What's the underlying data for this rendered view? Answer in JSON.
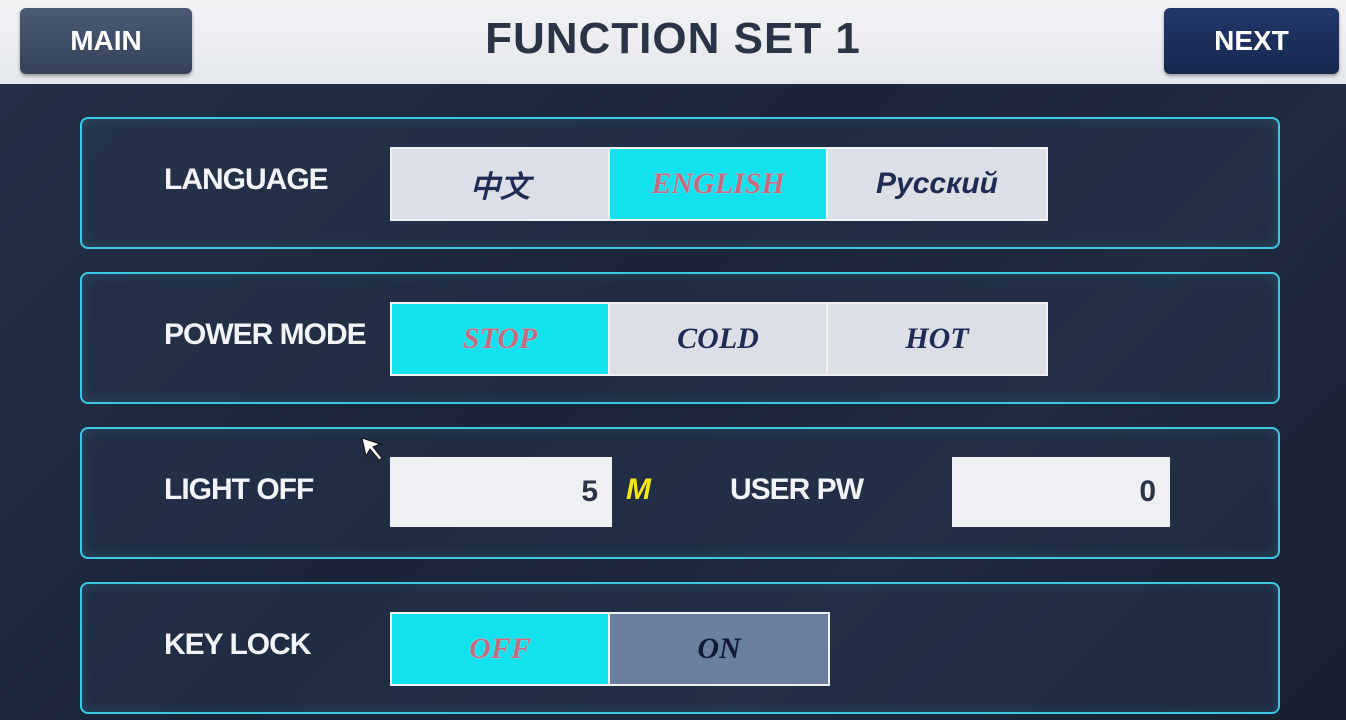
{
  "header": {
    "title": "FUNCTION SET 1",
    "main_label": "MAIN",
    "next_label": "NEXT"
  },
  "language": {
    "label": "LANGUAGE",
    "options": [
      "中文",
      "ENGLISH",
      "Русский"
    ],
    "selected": "ENGLISH"
  },
  "power_mode": {
    "label": "POWER MODE",
    "options": [
      "STOP",
      "COLD",
      "HOT"
    ],
    "selected": "STOP"
  },
  "light_off": {
    "label": "LIGHT OFF",
    "value": "5",
    "unit": "M"
  },
  "user_pw": {
    "label": "USER PW",
    "value": "0"
  },
  "key_lock": {
    "label": "KEY LOCK",
    "options": [
      "OFF",
      "ON"
    ],
    "selected": "OFF"
  },
  "colors": {
    "accent_active": "#12e2ee",
    "panel_border": "#3cc7e6",
    "unit_color": "#f3e516"
  },
  "icons": [
    "pointer-cursor-icon"
  ]
}
